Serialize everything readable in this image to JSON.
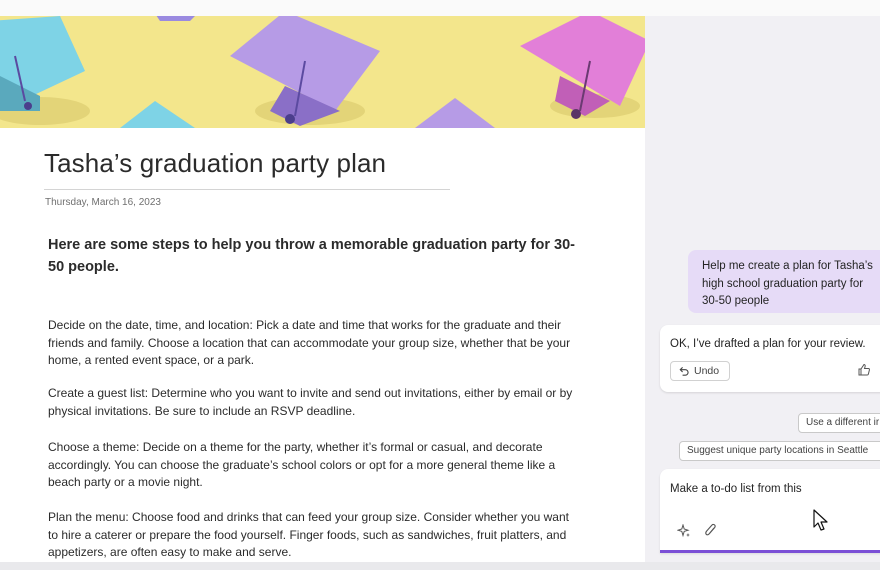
{
  "document": {
    "title": "Tasha’s graduation party plan",
    "date": "Thursday, March 16, 2023",
    "intro": "Here are some steps to help you throw a memorable graduation party for 30-50 people.",
    "sections": [
      {
        "heading": "Decide on the date, time, and location:",
        "body": " Pick a date and time that works for the graduate and their friends and family. Choose a location that can accommodate your group size, whether that be your home, a rented event space, or a park."
      },
      {
        "heading": "Create a guest list:",
        "body": " Determine who you want to invite and send out invitations, either by email or by physical invitations. Be sure to include an RSVP deadline."
      },
      {
        "heading": "Choose a theme:",
        "body": " Decide on a theme for the party, whether it’s formal or casual, and decorate accordingly. You can choose the graduate’s school colors or opt for a more general theme like a beach party or a movie night."
      },
      {
        "heading": "Plan the menu:",
        "body": " Choose food and drinks that can feed your group size. Consider whether you want to hire a caterer or prepare the food yourself. Finger foods, such as sandwiches, fruit platters, and appetizers, are often easy to make and serve."
      }
    ]
  },
  "chat": {
    "user_message": "Help me create a plan for Tasha’s high school graduation party for 30-50 people",
    "ai_message": "OK, I’ve drafted a plan for your review.",
    "undo_label": "Undo",
    "suggestions": [
      "Use a different ir",
      "Suggest unique party locations in Seattle"
    ],
    "input_value": "Make a to-do list from this"
  },
  "icons": {
    "undo": "undo-icon",
    "thumbs_up": "thumbs-up-icon",
    "sparkle": "sparkle-icon",
    "attach": "paperclip-icon",
    "cursor": "mouse-cursor-icon"
  },
  "colors": {
    "banner_bg": "#f3e68c",
    "user_bubble": "#e6dbf7",
    "accent": "#7b4fd6",
    "pane_bg": "#f1f0f4"
  }
}
